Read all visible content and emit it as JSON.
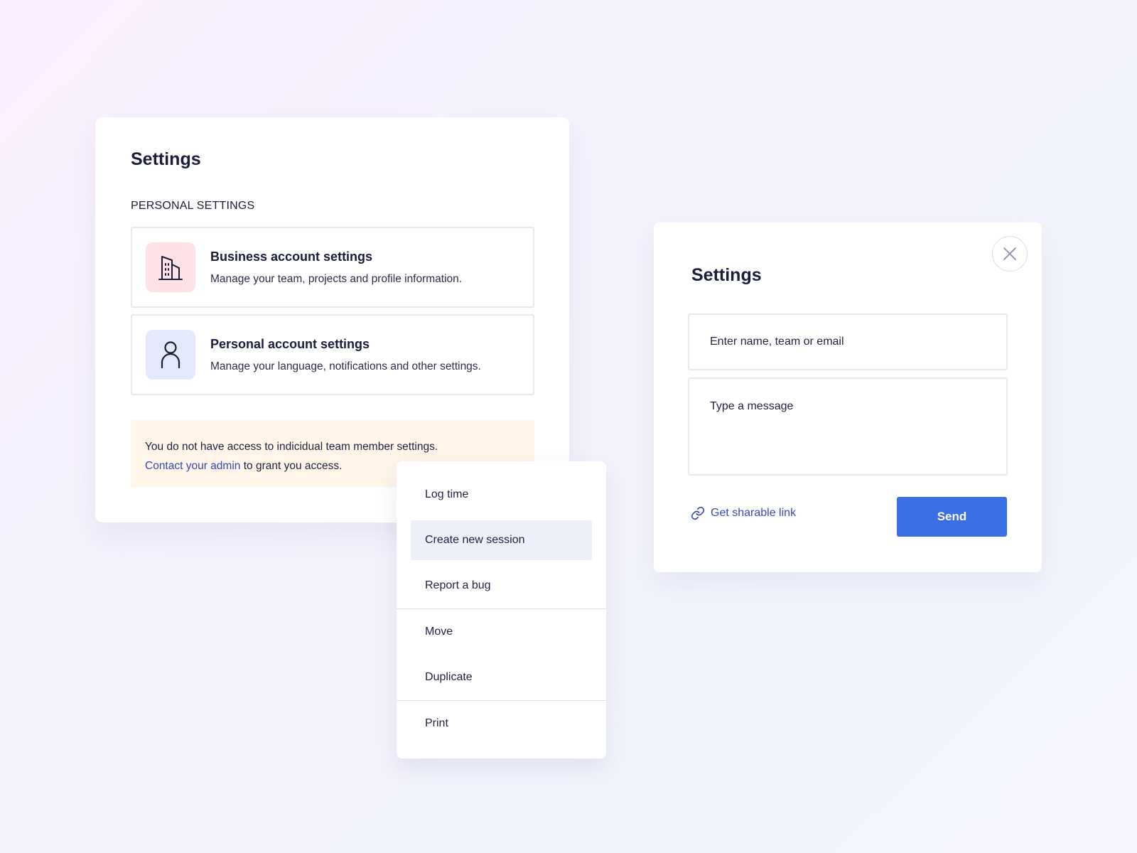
{
  "settings_card": {
    "title": "Settings",
    "section_label": "PERSONAL SETTINGS",
    "options": [
      {
        "icon": "building-icon",
        "title": "Business account settings",
        "description": "Manage your team, projects and profile information."
      },
      {
        "icon": "user-icon",
        "title": "Personal account settings",
        "description": "Manage your language, notifications and other settings."
      }
    ],
    "notice": {
      "text": "You do not have access to indicidual team member settings.",
      "link": "Contact your admin",
      "suffix": " to grant you access."
    }
  },
  "menu": {
    "items": [
      {
        "label": "Log time"
      },
      {
        "label": "Create new session",
        "active": true
      },
      {
        "label": "Report a bug"
      },
      {
        "label": "Move"
      },
      {
        "label": "Duplicate"
      },
      {
        "label": "Print"
      }
    ]
  },
  "dialog": {
    "title": "Settings",
    "recipient_placeholder": "Enter name, team or email",
    "message_placeholder": "Type a message",
    "share_link_label": "Get sharable link",
    "send_label": "Send"
  },
  "colors": {
    "accent": "#3a6ee5",
    "link": "#3648b8",
    "notice_bg": "#fff5e8",
    "business_icon_bg": "#fde1e6",
    "personal_icon_bg": "#e3e8fb"
  }
}
